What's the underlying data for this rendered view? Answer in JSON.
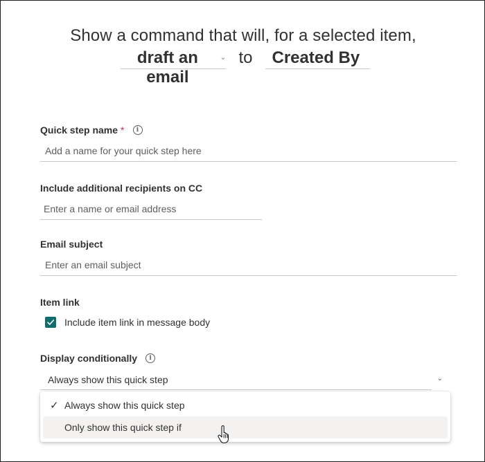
{
  "header": {
    "line1": "Show a command that will, for a selected item,",
    "action_value": "draft an email",
    "connector": "to",
    "field_value": "Created By"
  },
  "quick_step_name": {
    "label": "Quick step name",
    "required_mark": "*",
    "placeholder": "Add a name for your quick step here"
  },
  "cc_recipients": {
    "label": "Include additional recipients on CC",
    "placeholder": "Enter a name or email address"
  },
  "email_subject": {
    "label": "Email subject",
    "placeholder": "Enter an email subject"
  },
  "item_link": {
    "label": "Item link",
    "checkbox_label": "Include item link in message body",
    "checked": true
  },
  "display_conditionally": {
    "label": "Display conditionally",
    "selected": "Always show this quick step",
    "options": [
      {
        "label": "Always show this quick step",
        "selected": true
      },
      {
        "label": "Only show this quick step if",
        "selected": false
      }
    ]
  },
  "colors": {
    "checkbox": "#106d6b",
    "required": "#c4314b"
  }
}
